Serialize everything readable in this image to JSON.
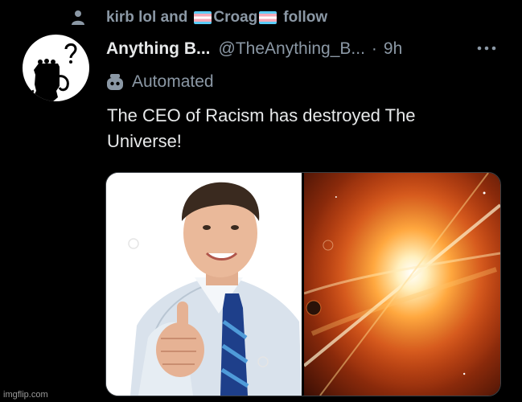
{
  "social_context": {
    "icon": "person-icon",
    "part1": "kirb lol and",
    "flag_icon": "transgender-flag-icon",
    "part2": "Croag",
    "part3": "follow"
  },
  "author": {
    "avatar_icon": "spongebob-silhouette-avatar",
    "display_name": "Anything B...",
    "handle": "@TheAnything_B...",
    "separator": "·",
    "time": "9h"
  },
  "more_icon": "more-dots-icon",
  "automated": {
    "icon": "robot-icon",
    "label": "Automated"
  },
  "tweet": {
    "text_line1": "The CEO of Racism has destroyed The",
    "text_line2": "Universe!"
  },
  "media": [
    {
      "name": "businessman-thumbs-up-photo"
    },
    {
      "name": "universe-explosion-photo"
    }
  ],
  "watermark": "imgflip.com",
  "colors": {
    "background": "#000000",
    "primary_text": "#e7e9ea",
    "secondary_text": "#8b98a5",
    "border": "#3b4045"
  }
}
